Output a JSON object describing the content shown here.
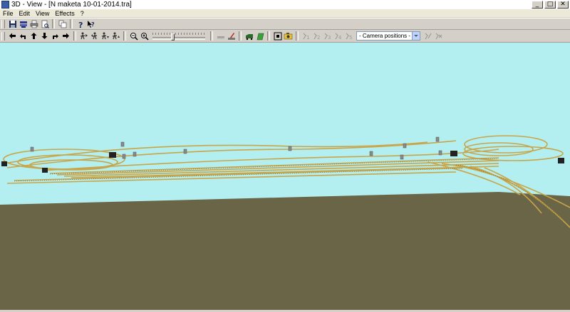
{
  "window": {
    "title": "3D - View - [N maketa 10-01-2014.tra]",
    "controls": {
      "minimize": "_",
      "maximize": "□",
      "close": "✕"
    }
  },
  "menu": [
    "File",
    "Edit",
    "View",
    "Effects",
    "?"
  ],
  "toolbar_row1": [
    {
      "name": "save-icon",
      "interactable": true
    },
    {
      "name": "layers-icon",
      "interactable": true
    },
    {
      "name": "print-icon",
      "interactable": true
    },
    {
      "name": "print-preview-icon",
      "interactable": true
    },
    {
      "name": "copy-icon",
      "interactable": true
    },
    {
      "name": "help-icon",
      "interactable": true
    },
    {
      "name": "context-help-icon",
      "interactable": true
    }
  ],
  "toolbar_row2": {
    "camera_dropdown": {
      "value": "- Camera positions -"
    }
  },
  "colors": {
    "sky": "#b3eff0",
    "ground": "#6b6547",
    "track": "#c9a54a",
    "window_bg": "#d4d0c8"
  }
}
